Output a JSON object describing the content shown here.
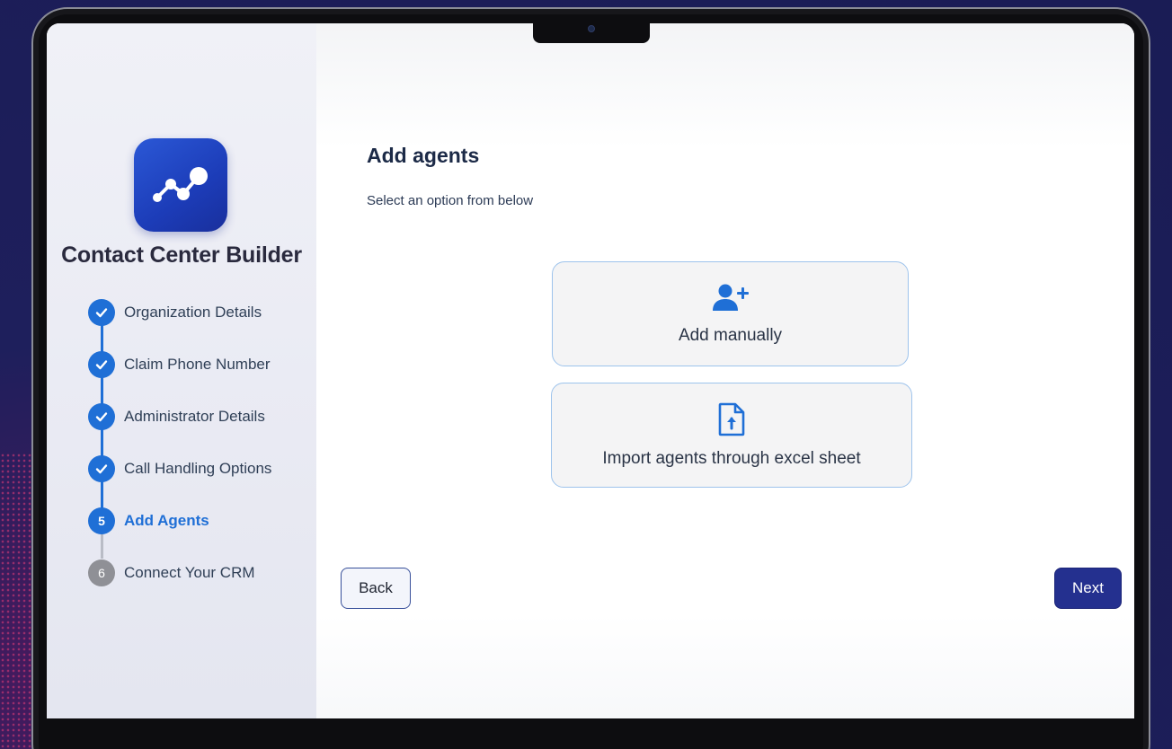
{
  "brand": {
    "name": "Contact Center Builder",
    "logo_icon": "connected-nodes-icon",
    "logo_color": "#1f3fbf"
  },
  "steps": [
    {
      "number": "1",
      "label": "Organization Details",
      "status": "completed"
    },
    {
      "number": "2",
      "label": "Claim Phone Number",
      "status": "completed"
    },
    {
      "number": "3",
      "label": "Administrator Details",
      "status": "completed"
    },
    {
      "number": "4",
      "label": "Call Handling Options",
      "status": "completed"
    },
    {
      "number": "5",
      "label": "Add Agents",
      "status": "active"
    },
    {
      "number": "6",
      "label": "Connect Your CRM",
      "status": "pending"
    }
  ],
  "main": {
    "title": "Add agents",
    "subtitle": "Select an option from below",
    "options": [
      {
        "label": "Add manually",
        "icon": "add-user-icon"
      },
      {
        "label": "Import agents through excel sheet",
        "icon": "file-upload-icon"
      }
    ]
  },
  "footer": {
    "back_label": "Back",
    "next_label": "Next"
  },
  "colors": {
    "accent": "#1f6fd6",
    "primary_button": "#24308f",
    "pending_step": "#8f9096"
  }
}
